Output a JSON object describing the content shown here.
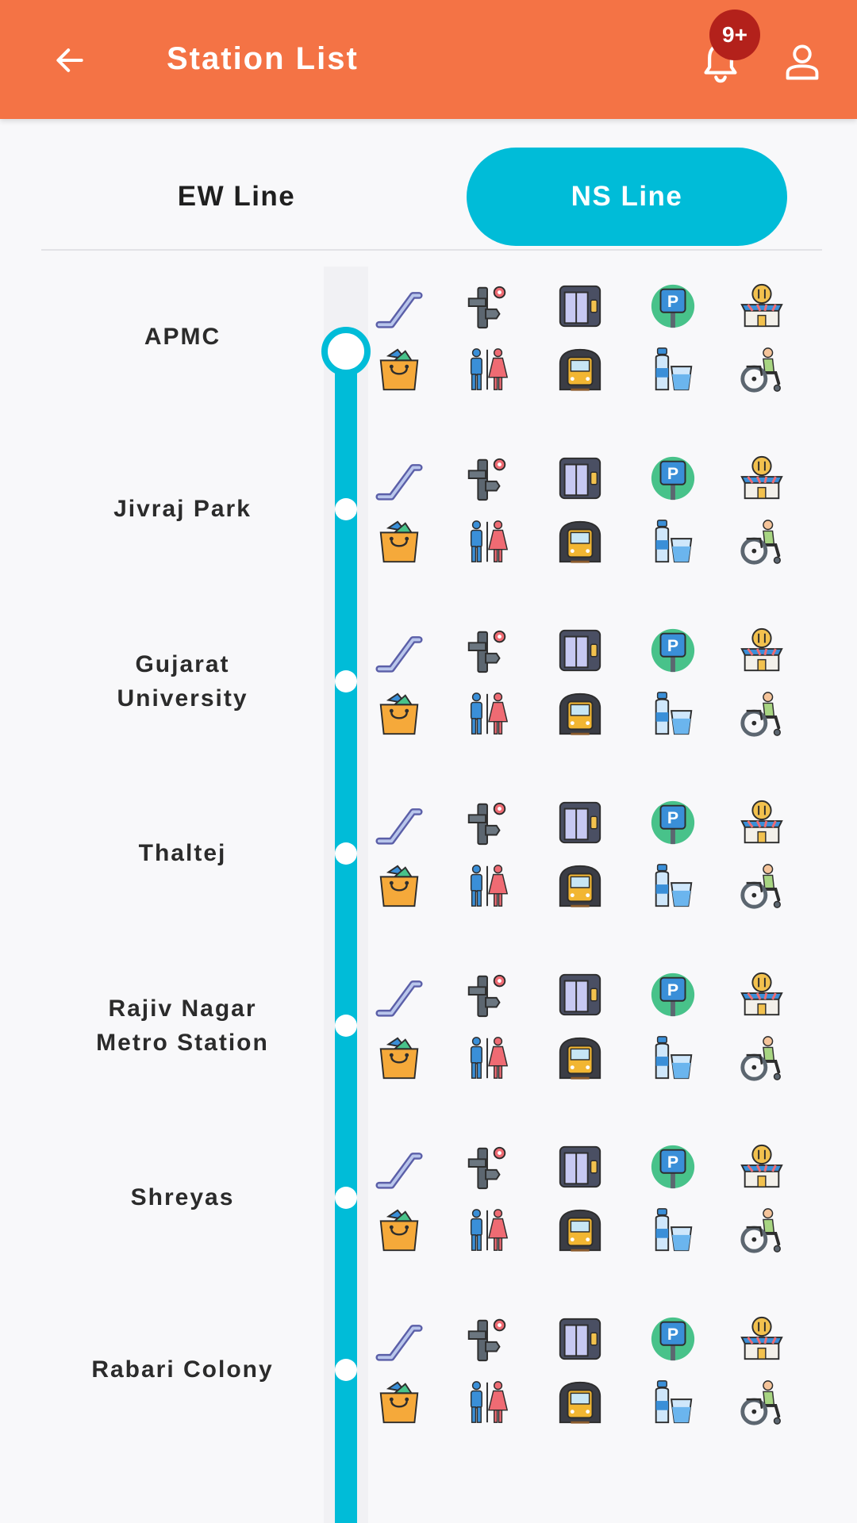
{
  "header": {
    "title": "Station List",
    "notification_badge": "9+"
  },
  "tabs": [
    {
      "label": "EW Line",
      "selected": false
    },
    {
      "label": "NS Line",
      "selected": true
    }
  ],
  "stations": [
    {
      "name": "APMC"
    },
    {
      "name": "Jivraj Park"
    },
    {
      "name": "Gujarat\nUniversity"
    },
    {
      "name": "Thaltej"
    },
    {
      "name": "Rajiv Nagar\nMetro Station"
    },
    {
      "name": "Shreyas"
    },
    {
      "name": "Rabari Colony"
    }
  ],
  "amenity_icons": [
    "escalator-icon",
    "direction-sign-icon",
    "lift-icon",
    "parking-icon",
    "food-court-icon",
    "shopping-bag-icon",
    "restroom-icon",
    "metro-train-icon",
    "drinking-water-icon",
    "wheelchair-icon"
  ],
  "colors": {
    "appbar": "#f47345",
    "accent": "#00bcd8",
    "badge": "#b3211b",
    "background": "#f8f8fa"
  }
}
